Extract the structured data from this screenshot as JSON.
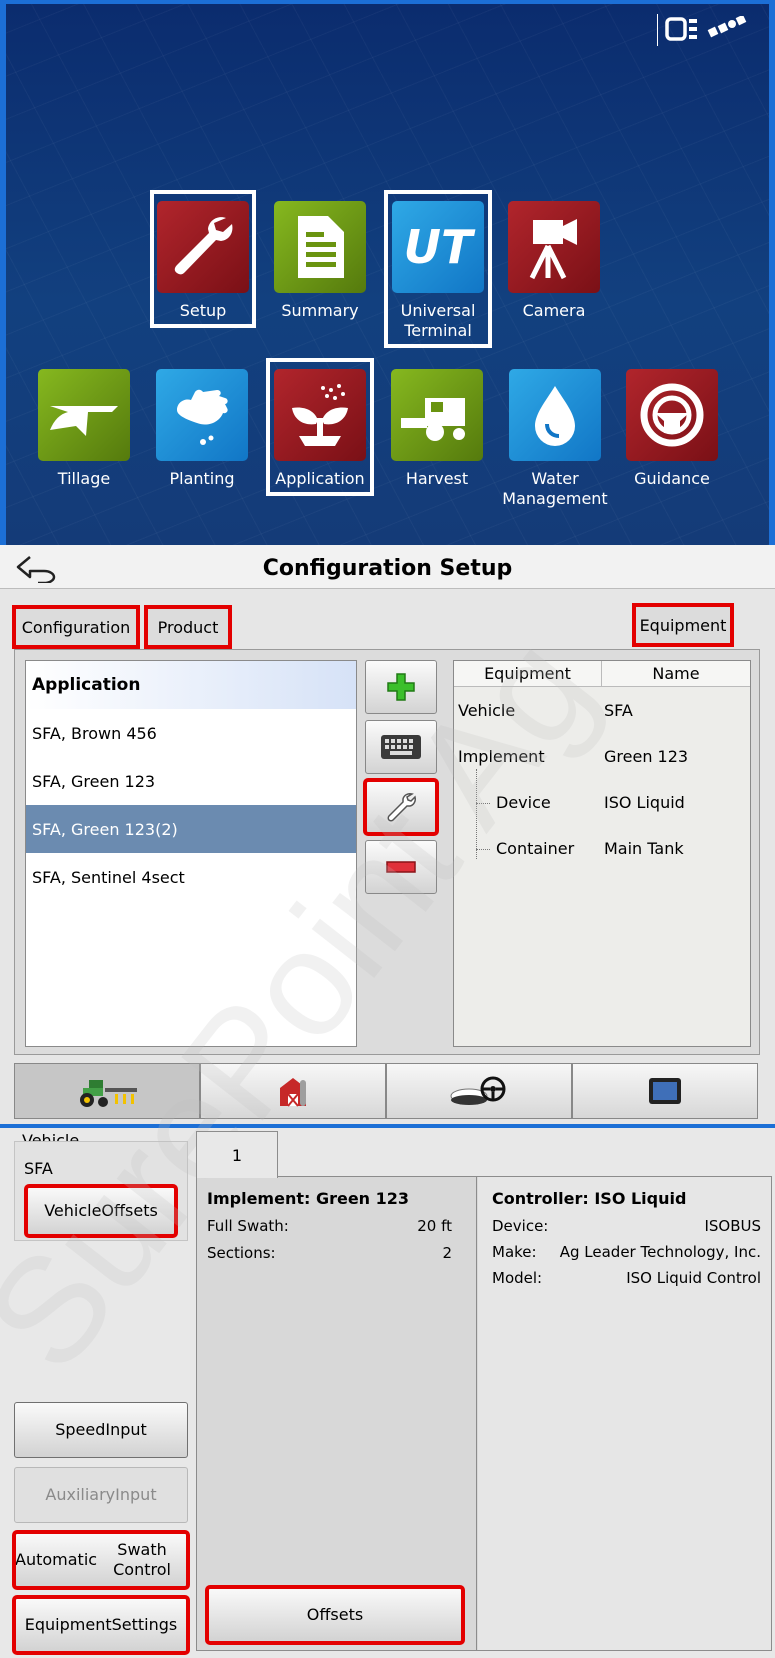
{
  "home": {
    "tiles": [
      {
        "label": "Setup",
        "icon": "wrench-icon"
      },
      {
        "label": "Summary",
        "icon": "document-icon"
      },
      {
        "label": "Universal Terminal",
        "icon": "ut-icon"
      },
      {
        "label": "Camera",
        "icon": "camera-icon"
      },
      {
        "label": "Tillage",
        "icon": "plow-icon"
      },
      {
        "label": "Planting",
        "icon": "hand-seed-icon"
      },
      {
        "label": "Application",
        "icon": "sprouting-plant-icon"
      },
      {
        "label": "Harvest",
        "icon": "combine-icon"
      },
      {
        "label": "Water Management",
        "icon": "water-drop-icon"
      },
      {
        "label": "Guidance",
        "icon": "steering-wheel-icon"
      }
    ],
    "tile_labels": {
      "universal_terminal_1": "Universal",
      "universal_terminal_2": "Terminal",
      "water_management_1": "Water",
      "water_management_2": "Management"
    },
    "status_icons": [
      "device-status-icon",
      "gps-satellite-icon"
    ],
    "ut_glyph": "UT"
  },
  "config": {
    "title": "Configuration Setup",
    "tabs": {
      "configuration": "Configuration",
      "product": "Product",
      "equipment": "Equipment"
    },
    "list_header": "Application",
    "list_items": [
      "SFA, Brown 456",
      "SFA, Green 123",
      "SFA, Green 123(2)",
      "SFA, Sentinel 4sect"
    ],
    "selected_item": "SFA, Green 123(2)",
    "side_buttons": [
      "add-icon",
      "keyboard-icon",
      "wrench-icon",
      "remove-icon"
    ],
    "equipment_table": {
      "headers": [
        "Equipment",
        "Name"
      ],
      "rows": [
        {
          "equipment": "Vehicle",
          "name": "SFA"
        },
        {
          "equipment": "Implement",
          "name": "Green 123"
        },
        {
          "equipment": "Device",
          "name": "ISO Liquid"
        },
        {
          "equipment": "Container",
          "name": "Main Tank"
        }
      ]
    },
    "bottom_tabs": [
      "tractor-icon",
      "barn-icon",
      "gps-steering-icon",
      "display-icon"
    ]
  },
  "equipment": {
    "vehicle_header": "Vehicle",
    "vehicle_name": "SFA",
    "buttons": {
      "vehicle_offsets_1": "Vehicle",
      "vehicle_offsets_2": "Offsets",
      "speed_input_1": "Speed",
      "speed_input_2": "Input",
      "aux_input_1": "Auxiliary",
      "aux_input_2": "Input",
      "auto_swath_1": "Automatic",
      "auto_swath_2": "Swath Control",
      "equip_settings_1": "Equipment",
      "equip_settings_2": "Settings",
      "offsets": "Offsets"
    },
    "tab_label": "1",
    "implement": {
      "title": "Implement: Green 123",
      "full_swath_label": "Full Swath:",
      "full_swath_value": "20 ft",
      "sections_label": "Sections:",
      "sections_value": "2"
    },
    "controller": {
      "title": "Controller: ISO Liquid",
      "device_label": "Device:",
      "device_value": "ISOBUS",
      "make_label": "Make:",
      "make_value": "Ag Leader Technology, Inc.",
      "model_label": "Model:",
      "model_value": "ISO Liquid Control"
    }
  },
  "watermark": "SurePoint Ag",
  "colors": {
    "highlight_red": "#e30000",
    "accent_blue": "#1c6fd6",
    "selection": "#6b8bb0"
  }
}
